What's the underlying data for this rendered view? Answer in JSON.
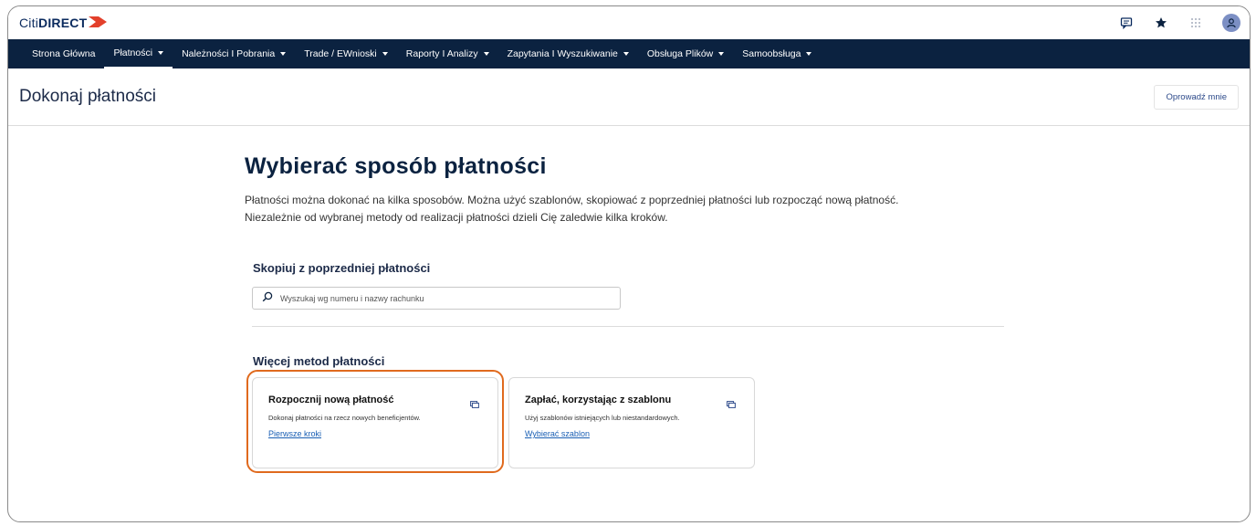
{
  "app": {
    "logo_citi": "Citi",
    "logo_direct": "DIRECT",
    "brand_color": "#0b2240",
    "accent_color": "#e3402b"
  },
  "top_icons": [
    "chat-icon",
    "star-icon",
    "apps-grid-icon",
    "user-avatar-icon"
  ],
  "nav": {
    "items": [
      {
        "label": "Strona Główna",
        "dropdown": false
      },
      {
        "label": "Płatności",
        "dropdown": true,
        "active": true
      },
      {
        "label": "Należności I Pobrania",
        "dropdown": true
      },
      {
        "label": "Trade / EWnioski",
        "dropdown": true
      },
      {
        "label": "Raporty I Analizy",
        "dropdown": true
      },
      {
        "label": "Zapytania I Wyszukiwanie",
        "dropdown": true
      },
      {
        "label": "Obsługa Plików",
        "dropdown": true
      },
      {
        "label": "Samoobsługa",
        "dropdown": true
      }
    ]
  },
  "page": {
    "title": "Dokonaj płatności",
    "guide_button": "Oprowadź mnie"
  },
  "main": {
    "heading": "Wybierać sposób płatności",
    "description_line1": "Płatności można dokonać na kilka sposobów. Można użyć szablonów, skopiować z poprzedniej płatności lub rozpocząć nową płatność.",
    "description_line2": "Niezależnie od wybranej metody od realizacji płatności dzieli Cię zaledwie kilka kroków.",
    "copy_section_title": "Skopiuj z poprzedniej płatności",
    "search_placeholder": "Wyszukaj wg numeru i nazwy rachunku",
    "more_methods_title": "Więcej metod płatności"
  },
  "cards": [
    {
      "title": "Rozpocznij nową płatność",
      "description": "Dokonaj płatności na rzecz nowych beneficjentów.",
      "link": "Pierwsze kroki",
      "icon": "card-stack-icon",
      "highlighted": true
    },
    {
      "title": "Zapłać, korzystając z szablonu",
      "description": "Użyj szablonów istniejących lub niestandardowych.",
      "link": "Wybierać szablon",
      "icon": "card-stack-icon",
      "highlighted": false
    }
  ],
  "highlight_color": "#e06a1e"
}
